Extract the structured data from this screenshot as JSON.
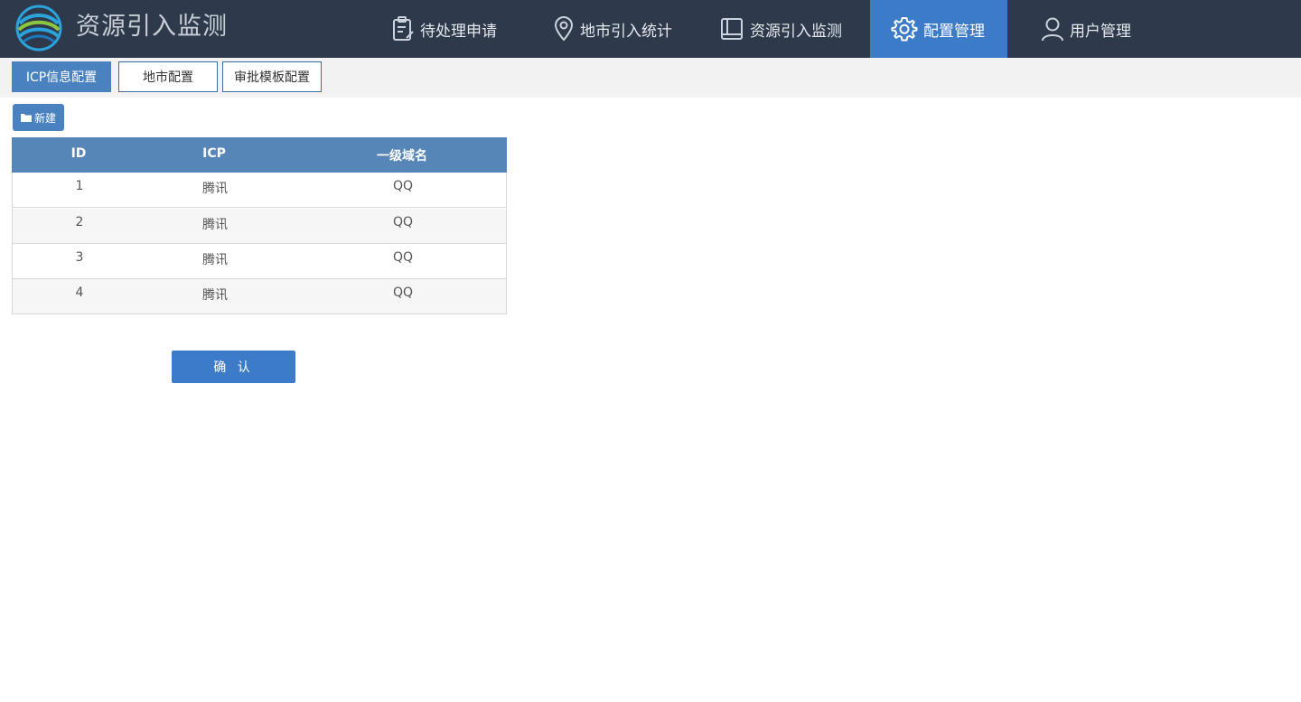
{
  "app": {
    "title": "资源引入监测"
  },
  "nav": {
    "items": [
      {
        "label": "待处理申请"
      },
      {
        "label": "地市引入统计"
      },
      {
        "label": "资源引入监测"
      },
      {
        "label": "配置管理"
      },
      {
        "label": "用户管理"
      }
    ],
    "active_index": 3
  },
  "subtabs": {
    "items": [
      {
        "label": "ICP信息配置"
      },
      {
        "label": "地市配置"
      },
      {
        "label": "审批模板配置"
      }
    ],
    "active_index": 0
  },
  "toolbar": {
    "new_label": "新建"
  },
  "table": {
    "columns": [
      "ID",
      "ICP",
      "一级域名"
    ],
    "rows": [
      [
        "1",
        "腾讯",
        "QQ"
      ],
      [
        "2",
        "腾讯",
        "QQ"
      ],
      [
        "3",
        "腾讯",
        "QQ"
      ],
      [
        "4",
        "腾讯",
        "QQ"
      ]
    ]
  },
  "actions": {
    "confirm_label": "确 认"
  },
  "colors": {
    "topbar": "#2e3a4b",
    "accent": "#3c7bc8",
    "table_header": "#5685b8"
  }
}
